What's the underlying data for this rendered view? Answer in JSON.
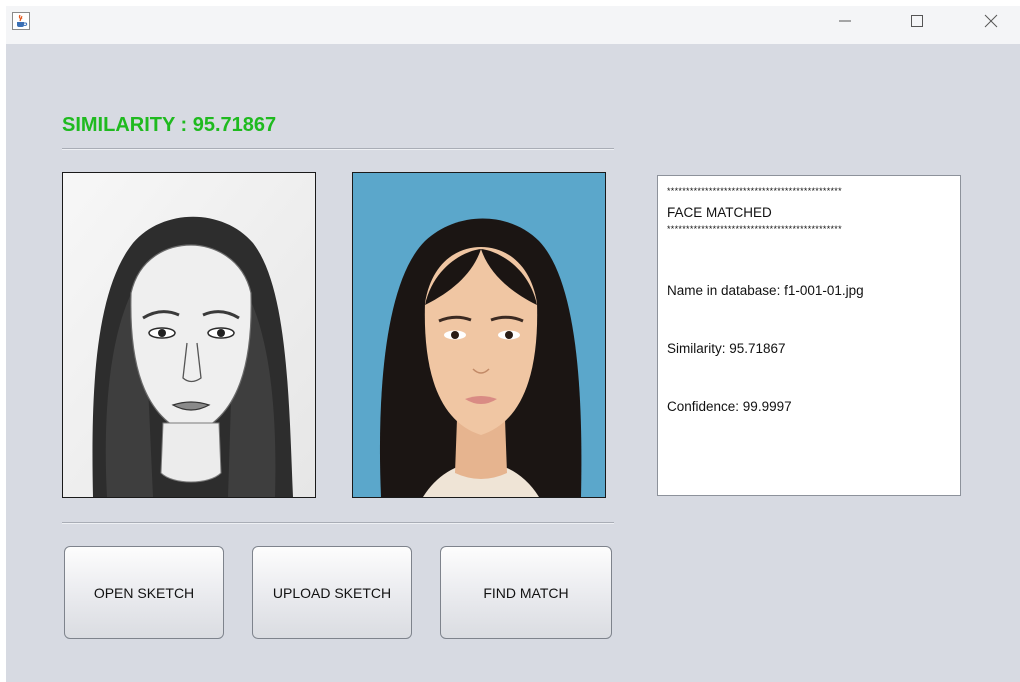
{
  "window": {
    "title": "",
    "icon": "java-cup-icon",
    "controls": [
      "minimize-icon",
      "maximize-icon",
      "close-icon"
    ]
  },
  "similarity_header": "SIMILARITY : 95.71867",
  "images": {
    "sketch": "pencil-sketch-portrait",
    "photo": "face-photo-portrait"
  },
  "result": {
    "stars_top": "**********************************************",
    "status": "FACE MATCHED",
    "stars_bottom": "**********************************************",
    "name_line": "Name in database: f1-001-01.jpg",
    "similarity_line": "Similarity: 95.71867",
    "confidence_line": "Confidence: 99.9997"
  },
  "buttons": {
    "open": "OPEN SKETCH",
    "upload": "UPLOAD SKETCH",
    "find": "FIND MATCH"
  },
  "colors": {
    "similarity_text": "#1fba1f",
    "window_bg": "#d7dae2",
    "photo_bg": "#5ba7cb"
  }
}
